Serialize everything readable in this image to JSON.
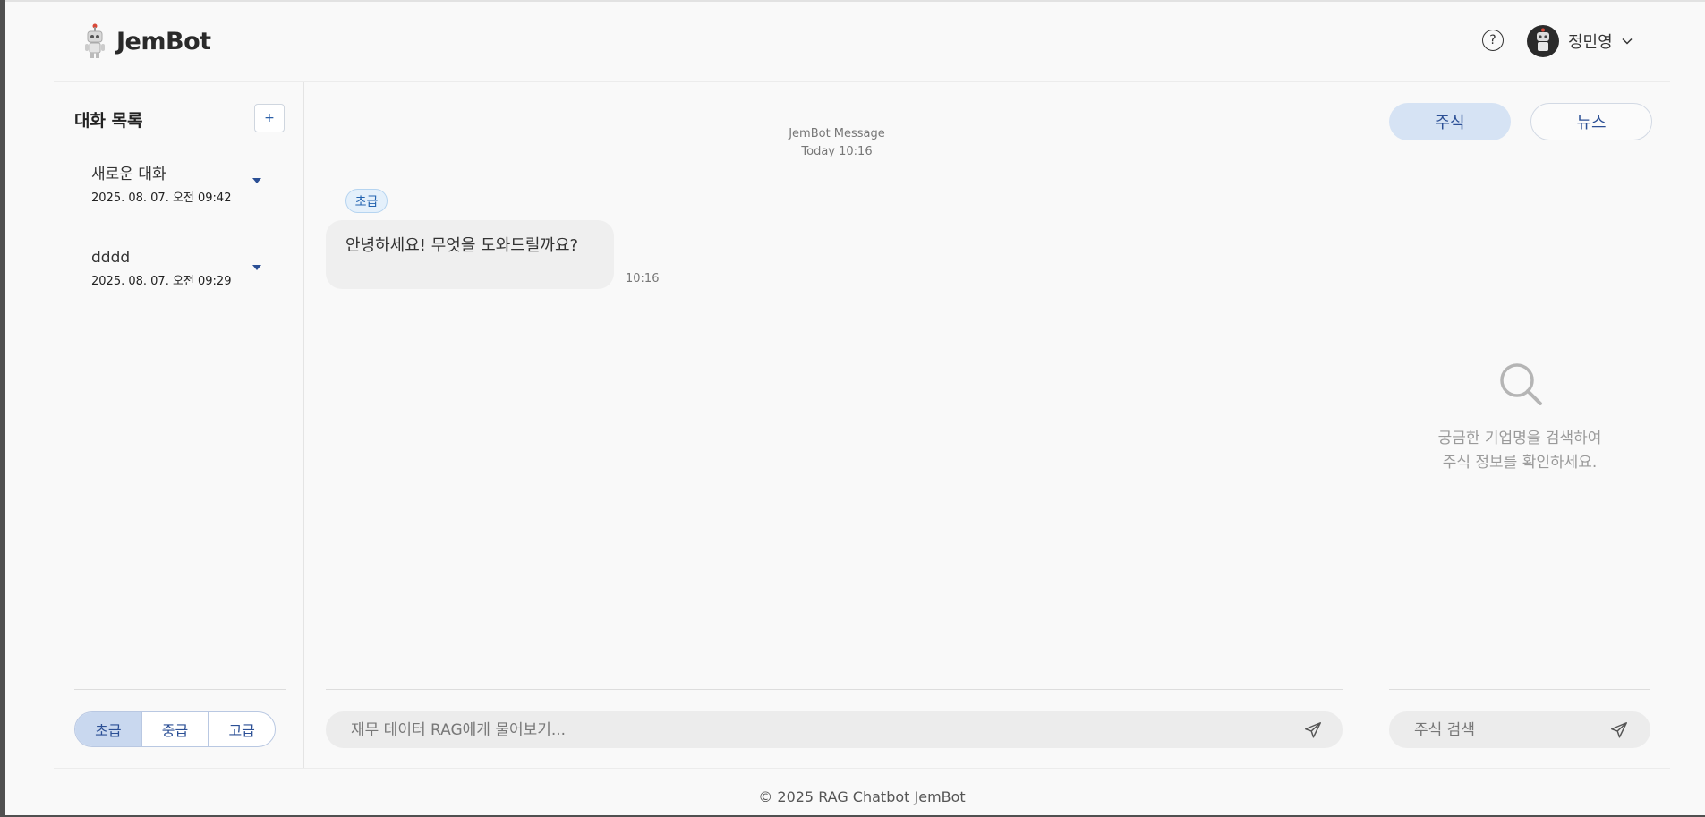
{
  "header": {
    "logo_text": "JemBot",
    "help_label": "?",
    "user_name": "정민영"
  },
  "sidebar": {
    "title": "대화 목록",
    "new_chat_label": "+",
    "conversations": [
      {
        "title": "새로운 대화",
        "date": "2025. 08. 07. 오전 09:42"
      },
      {
        "title": "dddd",
        "date": "2025. 08. 07. 오전 09:29"
      }
    ],
    "levels": [
      {
        "label": "초급",
        "active": true
      },
      {
        "label": "중급",
        "active": false
      },
      {
        "label": "고급",
        "active": false
      }
    ]
  },
  "chat": {
    "header_sender": "JemBot Message",
    "header_time": "Today 10:16",
    "messages": [
      {
        "level_tag": "초급",
        "text": "안녕하세요! 무엇을 도와드릴까요?",
        "time": "10:16"
      }
    ],
    "input_placeholder": "재무 데이터 RAG에게 물어보기..."
  },
  "right_panel": {
    "tabs": [
      {
        "label": "주식",
        "active": true
      },
      {
        "label": "뉴스",
        "active": false
      }
    ],
    "empty_line1": "궁금한 기업명을 검색하여",
    "empty_line2": "주식 정보를 확인하세요.",
    "search_placeholder": "주식 검색"
  },
  "footer": {
    "text": "© 2025 RAG Chatbot JemBot"
  },
  "colors": {
    "accent": "#2b4f95",
    "active_tab_bg": "#d6e3f4",
    "active_level_bg": "#c9d8ef"
  }
}
